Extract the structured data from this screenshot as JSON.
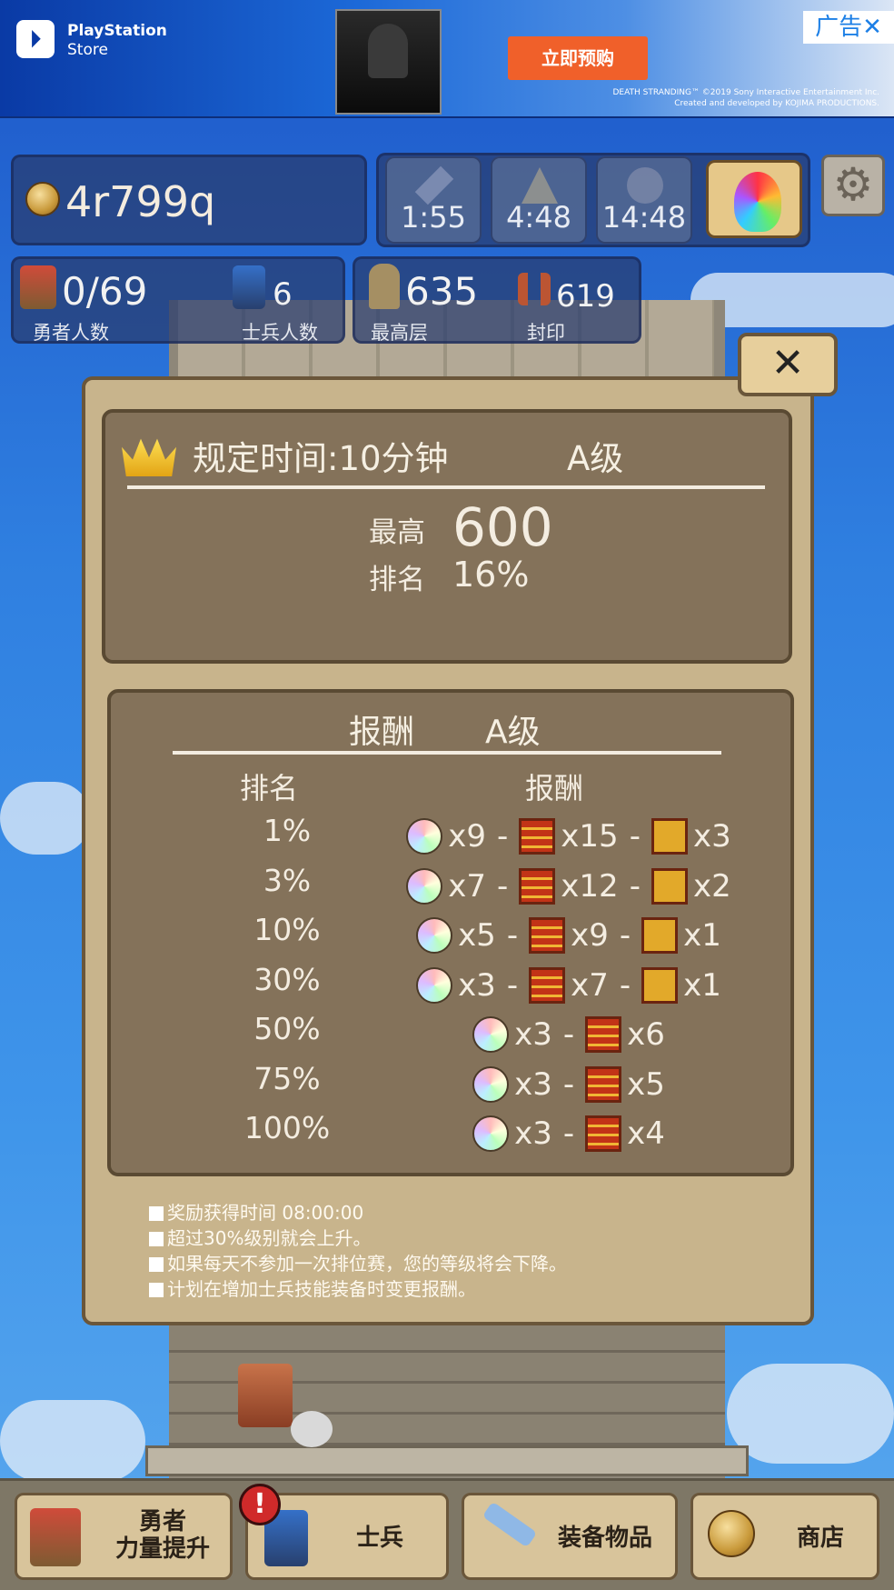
{
  "ad": {
    "brand_line1": "PlayStation",
    "brand_line2": "Store",
    "cta": "立即预购",
    "fine_line1": "DEATH STRANDING™ ©2019 Sony Interactive Entertainment Inc.",
    "fine_line2": "Created and developed by KOJIMA PRODUCTIONS.",
    "tag": "广告"
  },
  "hud": {
    "gold": "4r799q",
    "timers": [
      "1:55",
      "4:48",
      "14:48"
    ],
    "heroes": {
      "value": "0/69",
      "label": "勇者人数"
    },
    "soldiers": {
      "value": "6",
      "label": "士兵人数"
    },
    "floor": {
      "value": "635",
      "label": "最高层"
    },
    "seal": {
      "value": "619",
      "label": "封印"
    }
  },
  "dialog": {
    "close": "✕",
    "title": "规定时间:10分钟",
    "grade": "A级",
    "best_label": "最高",
    "best_value": "600",
    "rank_label": "排名",
    "rank_value": "16%",
    "rewards_title": "报酬",
    "rewards_grade": "A级",
    "col_rank": "排名",
    "col_reward": "报酬",
    "rows": [
      {
        "pct": "1%",
        "gems": "x9",
        "red": "x15",
        "gold": "x3"
      },
      {
        "pct": "3%",
        "gems": "x7",
        "red": "x12",
        "gold": "x2"
      },
      {
        "pct": "10%",
        "gems": "x5",
        "red": "x9",
        "gold": "x1"
      },
      {
        "pct": "30%",
        "gems": "x3",
        "red": "x7",
        "gold": "x1"
      },
      {
        "pct": "50%",
        "gems": "x3",
        "red": "x6"
      },
      {
        "pct": "75%",
        "gems": "x3",
        "red": "x5"
      },
      {
        "pct": "100%",
        "gems": "x3",
        "red": "x4"
      }
    ],
    "sep": "-",
    "notes": [
      "奖励获得时间 08:00:00",
      "超过30%级别就会上升。",
      "如果每天不参加一次排位赛，您的等级将会下降。",
      "计划在增加士兵技能装备时变更报酬。"
    ]
  },
  "tabs": {
    "hero_line1": "勇者",
    "hero_line2": "力量提升",
    "soldier": "士兵",
    "equip": "装备物品",
    "shop": "商店",
    "badge": "!"
  },
  "icons": [
    "crown-icon",
    "gem-icon",
    "red-chest-icon",
    "gold-chest-icon",
    "gear-icon",
    "close-icon"
  ]
}
